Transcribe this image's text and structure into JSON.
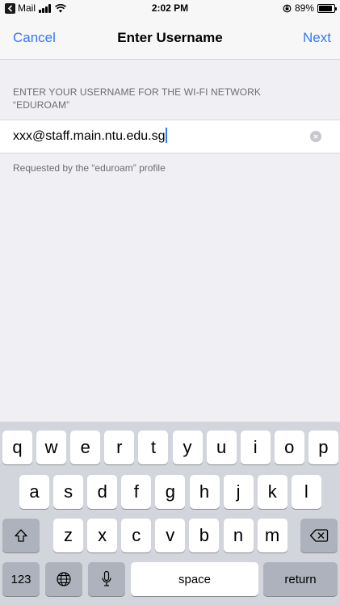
{
  "status_bar": {
    "back_app": "Mail",
    "time": "2:02 PM",
    "battery_percent": "89%",
    "battery_level": 0.89
  },
  "nav": {
    "cancel_label": "Cancel",
    "title": "Enter Username",
    "next_label": "Next"
  },
  "form": {
    "section_header": "ENTER YOUR USERNAME FOR THE WI-FI NETWORK “EDUROAM”",
    "username_value": "xxx@staff.main.ntu.edu.sg",
    "footer_note": "Requested by the “eduroam” profile"
  },
  "keyboard": {
    "row1": [
      "q",
      "w",
      "e",
      "r",
      "t",
      "y",
      "u",
      "i",
      "o",
      "p"
    ],
    "row2": [
      "a",
      "s",
      "d",
      "f",
      "g",
      "h",
      "j",
      "k",
      "l"
    ],
    "row3": [
      "z",
      "x",
      "c",
      "v",
      "b",
      "n",
      "m"
    ],
    "numbers_label": "123",
    "space_label": "space",
    "return_label": "return",
    "icons": {
      "shift": "shift-icon",
      "delete": "delete-icon",
      "globe": "globe-icon",
      "microphone": "microphone-icon"
    }
  },
  "colors": {
    "accent": "#3478f6",
    "background": "#efeff4",
    "keyboard_background": "#d2d5db"
  }
}
